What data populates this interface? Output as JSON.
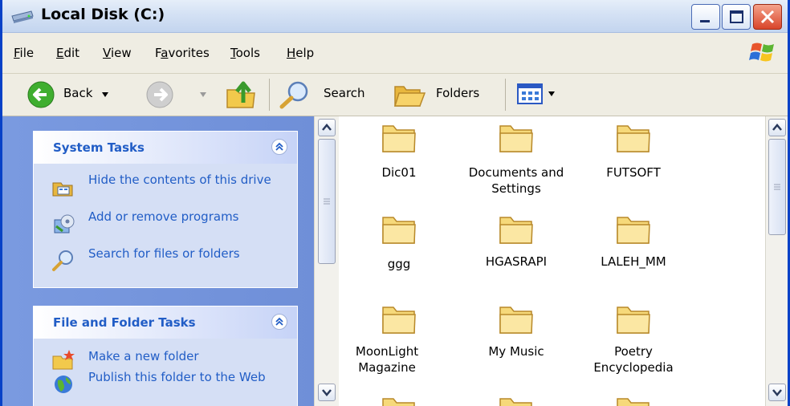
{
  "window": {
    "title": "Local Disk (C:)",
    "colors": {
      "titlebar": "#c3d5ef",
      "frame": "#0841c7",
      "close_button": "#d9452a",
      "task_link": "#215dc6",
      "pane_bg": "#7a9ae0"
    }
  },
  "menu": {
    "file": {
      "first": "F",
      "rest": "ile"
    },
    "edit": {
      "first": "E",
      "rest": "dit"
    },
    "view": {
      "first": "V",
      "rest": "iew"
    },
    "favorites": {
      "pre": "F",
      "under": "a",
      "rest": "vorites"
    },
    "tools": {
      "first": "T",
      "rest": "ools"
    },
    "help": {
      "first": "H",
      "rest": "elp"
    }
  },
  "toolbar": {
    "back_label": "Back",
    "search_label": "Search",
    "folders_label": "Folders"
  },
  "tasks_panel": {
    "system": {
      "title": "System Tasks",
      "items": [
        {
          "label": "Hide the contents of this drive",
          "icon": "drive-hide-icon"
        },
        {
          "label": "Add or remove programs",
          "icon": "add-remove-programs-icon"
        },
        {
          "label": "Search for files or folders",
          "icon": "search-icon"
        }
      ]
    },
    "file_folder": {
      "title": "File and Folder Tasks",
      "items": [
        {
          "label": "Make a new folder",
          "icon": "new-folder-icon"
        },
        {
          "label": "Publish this folder to the Web",
          "icon": "web-publish-icon"
        }
      ]
    }
  },
  "folders": [
    {
      "name": "Dic01"
    },
    {
      "name": "Documents and Settings"
    },
    {
      "name": "FUTSOFT"
    },
    {
      "name": "ggg"
    },
    {
      "name": "HGASRAPI"
    },
    {
      "name": "LALEH_MM"
    },
    {
      "name": "MoonLight Magazine"
    },
    {
      "name": "My Music"
    },
    {
      "name": "Poetry Encyclopedia"
    }
  ]
}
